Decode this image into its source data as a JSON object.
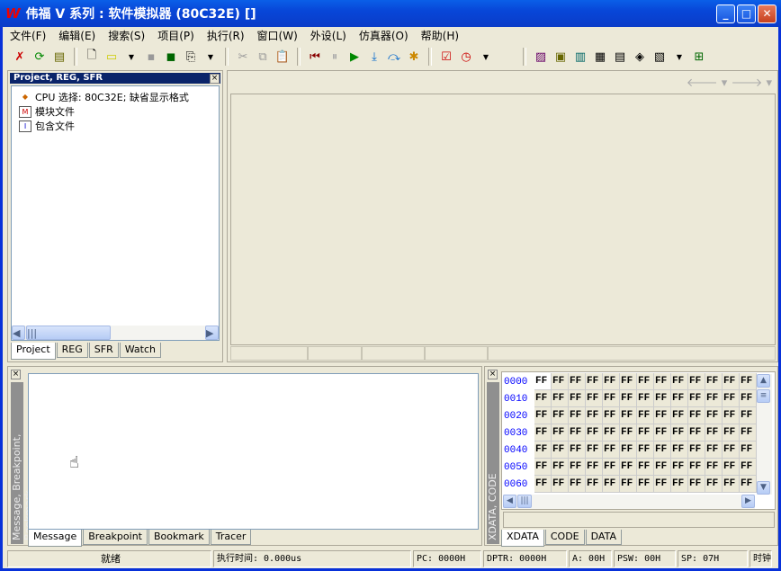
{
  "title": "伟福 V 系列 : 软件模拟器 (80C32E) []",
  "logo": "W",
  "menu": [
    "文件(F)",
    "编辑(E)",
    "搜索(S)",
    "项目(P)",
    "执行(R)",
    "窗口(W)",
    "外设(L)",
    "仿真器(O)",
    "帮助(H)"
  ],
  "project_panel": {
    "title": "Project, REG, SFR",
    "tree": [
      "CPU 选择: 80C32E; 缺省显示格式",
      "模块文件",
      "包含文件"
    ],
    "tabs": [
      "Project",
      "REG",
      "SFR",
      "Watch"
    ]
  },
  "message_panel": {
    "strip": "Message, Breakpoint, Bookmark",
    "tabs": [
      "Message",
      "Breakpoint",
      "Bookmark",
      "Tracer"
    ]
  },
  "memory_panel": {
    "strip": "XDATA, CODE",
    "tabs": [
      "XDATA",
      "CODE",
      "DATA"
    ],
    "addresses": [
      "0000",
      "0010",
      "0020",
      "0030",
      "0040",
      "0050",
      "0060"
    ],
    "value": "FF",
    "columns": 13
  },
  "status": [
    "就绪",
    "执行时间: 0.000us",
    "PC: 0000H",
    "DPTR: 0000H",
    "A: 00H",
    "PSW: 00H",
    "SP: 07H",
    "时钟"
  ]
}
